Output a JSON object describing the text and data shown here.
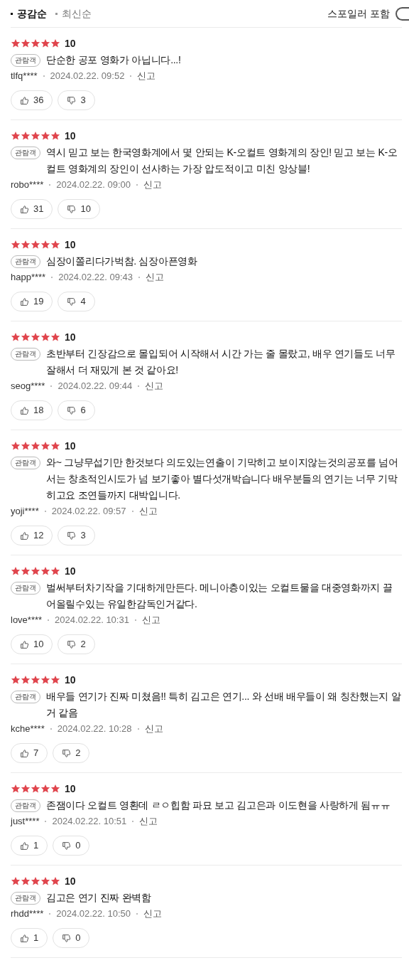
{
  "sort_tabs": [
    {
      "label": "공감순",
      "selected": true
    },
    {
      "label": "최신순",
      "selected": false
    }
  ],
  "spoiler_toggle": {
    "label": "스포일러 포함",
    "on": false
  },
  "reviews": [
    {
      "stars": 5,
      "score": "10",
      "badge": "관람객",
      "text": "단순한 공포 영화가 아닙니다...!",
      "user": "tlfq****",
      "date": "2024.02.22. 09:52",
      "report": "신고",
      "likes": "36",
      "dislikes": "3"
    },
    {
      "stars": 5,
      "score": "10",
      "badge": "관람객",
      "text": "역시 믿고 보는 한국영화계에서 몇 안되는 K-오컬트 영화계의 장인! 믿고 보는 K-오컬트 영화계의 장인이 선사하는 가장 압도적이고 미친 앙상블!",
      "user": "robo****",
      "date": "2024.02.22. 09:00",
      "report": "신고",
      "likes": "31",
      "dislikes": "10"
    },
    {
      "stars": 5,
      "score": "10",
      "badge": "관람객",
      "text": "심장이쫄리다가벅참. 심장아픈영화",
      "user": "happ****",
      "date": "2024.02.22. 09:43",
      "report": "신고",
      "likes": "19",
      "dislikes": "4"
    },
    {
      "stars": 5,
      "score": "10",
      "badge": "관람객",
      "text": "초반부터 긴장감으로 몰입되어 시작해서 시간 가는 줄 몰랐고, 배우 연기들도 너무 잘해서 더 재밌게 본 것 같아요!",
      "user": "seog****",
      "date": "2024.02.22. 09:44",
      "report": "신고",
      "likes": "18",
      "dislikes": "6"
    },
    {
      "stars": 5,
      "score": "10",
      "badge": "관람객",
      "text": "와~ 그냥무섭기만 한것보다 의도있는연출이 기막히고 보이지않는것의공포를 넘어서는 창초적인시도가 넘 보기좋아 별다섯개박습니다 배우분들의 연기는 너무 기막히고요 조연들까지 대박입니다.",
      "user": "yoji****",
      "date": "2024.02.22. 09:57",
      "report": "신고",
      "likes": "12",
      "dislikes": "3"
    },
    {
      "stars": 5,
      "score": "10",
      "badge": "관람객",
      "text": "벌써부터차기작을 기대하게만든다. 메니아층이있는 오컬트물을 대중영화까지 끌어올릴수있는 유일한감독인거같다.",
      "user": "love****",
      "date": "2024.02.22. 10:31",
      "report": "신고",
      "likes": "10",
      "dislikes": "2"
    },
    {
      "stars": 5,
      "score": "10",
      "badge": "관람객",
      "text": "배우들 연기가 진짜 미쳤음!! 특히 김고은 연기... 와 선배 배우들이 왜 칭찬했는지 알거 같음",
      "user": "kche****",
      "date": "2024.02.22. 10:28",
      "report": "신고",
      "likes": "7",
      "dislikes": "2"
    },
    {
      "stars": 5,
      "score": "10",
      "badge": "관람객",
      "text": "존잼이다 오컬트 영환데 ㄹㅇ힙함 파묘 보고 김고은과 이도현을 사랑하게 됨ㅠㅠ",
      "user": "just****",
      "date": "2024.02.22. 10:51",
      "report": "신고",
      "likes": "1",
      "dislikes": "0"
    },
    {
      "stars": 5,
      "score": "10",
      "badge": "관람객",
      "text": "김고은 연기 진짜 완벽함",
      "user": "rhdd****",
      "date": "2024.02.22. 10:50",
      "report": "신고",
      "likes": "1",
      "dislikes": "0"
    }
  ]
}
